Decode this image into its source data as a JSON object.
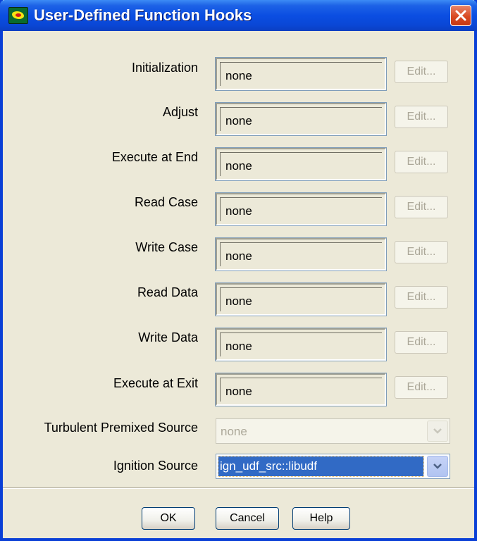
{
  "window": {
    "title": "User-Defined Function Hooks"
  },
  "hooks": [
    {
      "label": "Initialization",
      "value": "none",
      "edit_label": "Edit..."
    },
    {
      "label": "Adjust",
      "value": "none",
      "edit_label": "Edit..."
    },
    {
      "label": "Execute at End",
      "value": "none",
      "edit_label": "Edit..."
    },
    {
      "label": "Read Case",
      "value": "none",
      "edit_label": "Edit..."
    },
    {
      "label": "Write Case",
      "value": "none",
      "edit_label": "Edit..."
    },
    {
      "label": "Read Data",
      "value": "none",
      "edit_label": "Edit..."
    },
    {
      "label": "Write Data",
      "value": "none",
      "edit_label": "Edit..."
    },
    {
      "label": "Execute at Exit",
      "value": "none",
      "edit_label": "Edit..."
    }
  ],
  "turbulent_premixed_source": {
    "label": "Turbulent Premixed Source",
    "value": "none",
    "enabled": false
  },
  "ignition_source": {
    "label": "Ignition Source",
    "value": "ign_udf_src::libudf",
    "enabled": true
  },
  "buttons": {
    "ok": "OK",
    "cancel": "Cancel",
    "help": "Help"
  },
  "colors": {
    "titlebar": "#0b4ee2",
    "dialog_bg": "#ece9d8",
    "selection": "#316ac5",
    "close_button": "#d94a22"
  },
  "icons": {
    "app": "fluent-app-icon",
    "close": "close-icon",
    "dropdown": "chevron-down-icon"
  }
}
